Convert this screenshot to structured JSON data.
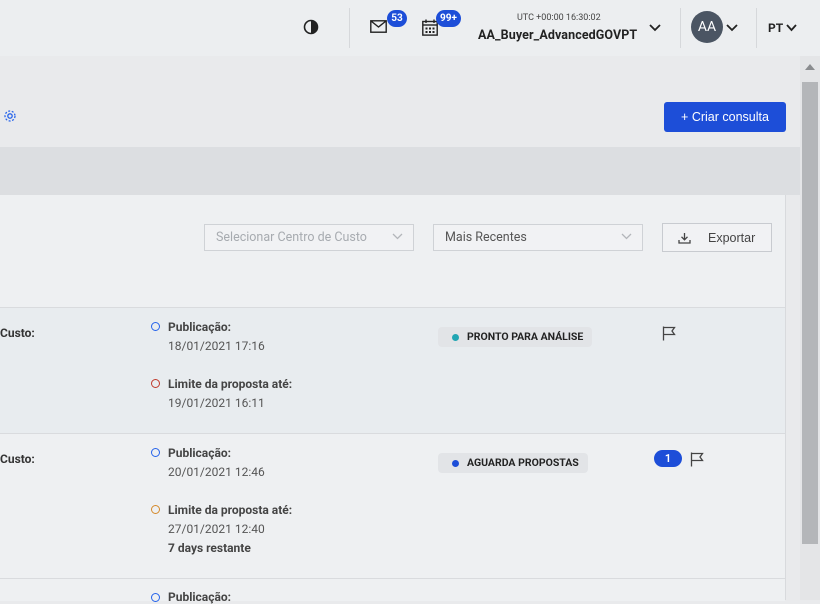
{
  "header": {
    "messages_badge": "53",
    "calendar_badge": "99+",
    "clock": "UTC +00:00 16:30:02",
    "username": "AA_Buyer_AdvancedGOVPT",
    "avatar_initials": "AA",
    "language": "PT",
    "icons": [
      "contrast-icon",
      "mail-icon",
      "calendar-icon",
      "chevron-down-icon"
    ]
  },
  "toolbar": {
    "create_label": "+ Criar consulta",
    "cost_center_placeholder": "Selecionar Centro de Custo",
    "sort_value": "Mais Recentes",
    "export_label": "Exportar"
  },
  "rows": [
    {
      "cost_label": "Custo:",
      "publication_label": "Publicação:",
      "publication_date": "18/01/2021 17:16",
      "deadline_label": "Limite da proposta até:",
      "deadline_date": "19/01/2021 16:11",
      "remaining": "",
      "status": "PRONTO PARA ANÁLISE",
      "count": ""
    },
    {
      "cost_label": "Custo:",
      "publication_label": "Publicação:",
      "publication_date": "20/01/2021 12:46",
      "deadline_label": "Limite da proposta até:",
      "deadline_date": "27/01/2021 12:40",
      "remaining": "7 days restante",
      "status": "AGUARDA PROPOSTAS",
      "count": "1"
    },
    {
      "publication_label": "Publicação:"
    }
  ],
  "colors": {
    "primary": "#1d4ed8",
    "status_ready": "#22a6b3",
    "status_waiting": "#1d4ed8",
    "deadline_red": "#c0392b",
    "deadline_orange": "#d4892a",
    "publication_blue": "#2563eb"
  }
}
